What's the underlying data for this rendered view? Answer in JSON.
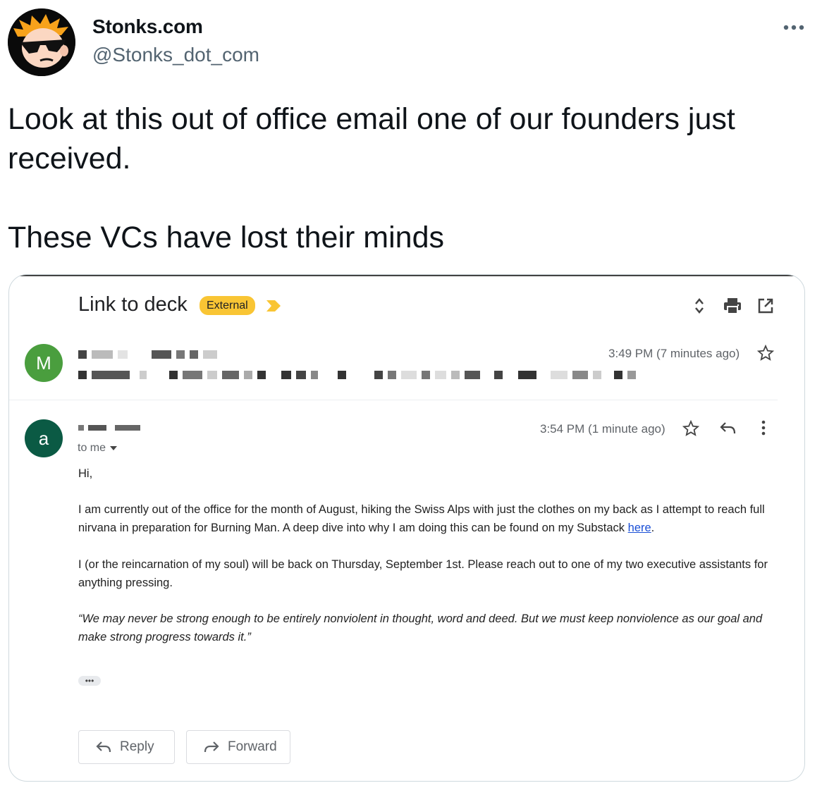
{
  "tweet": {
    "author_name": "Stonks.com",
    "author_handle": "@Stonks_dot_com",
    "text": "Look at this out of office email one of our founders just received.\n\nThese VCs have lost their minds"
  },
  "email": {
    "subject": "Link to deck",
    "badge": "External",
    "first_message": {
      "avatar_letter": "M",
      "time": "3:49 PM (7 minutes ago)",
      "avatar_color": "#4a9e3e"
    },
    "second_message": {
      "avatar_letter": "a",
      "time": "3:54 PM (1 minute ago)",
      "to_me": "to me",
      "avatar_color": "#0b5a44",
      "greeting": "Hi,",
      "paragraph1_before_link": "I am currently out of the office for the month of August, hiking the Swiss Alps with just the clothes on my back as I attempt to reach full nirvana in preparation for Burning Man. A deep dive into why I am doing this can be found on my Substack ",
      "paragraph1_link": "here",
      "paragraph1_after_link": ".",
      "paragraph2": "I (or the reincarnation of my soul) will be back on Thursday, September 1st. Please reach out to one of my two executive assistants for anything pressing.",
      "quote": "“We may never be strong enough to be entirely nonviolent in thought, word and deed. But we must keep nonviolence as our goal and make strong progress towards it.”",
      "ellipsis": "•••"
    },
    "reply_label": "Reply",
    "forward_label": "Forward"
  },
  "colors": {
    "badge": "#f9c534",
    "link": "#1a4fd6",
    "muted_text": "#5f6368"
  }
}
